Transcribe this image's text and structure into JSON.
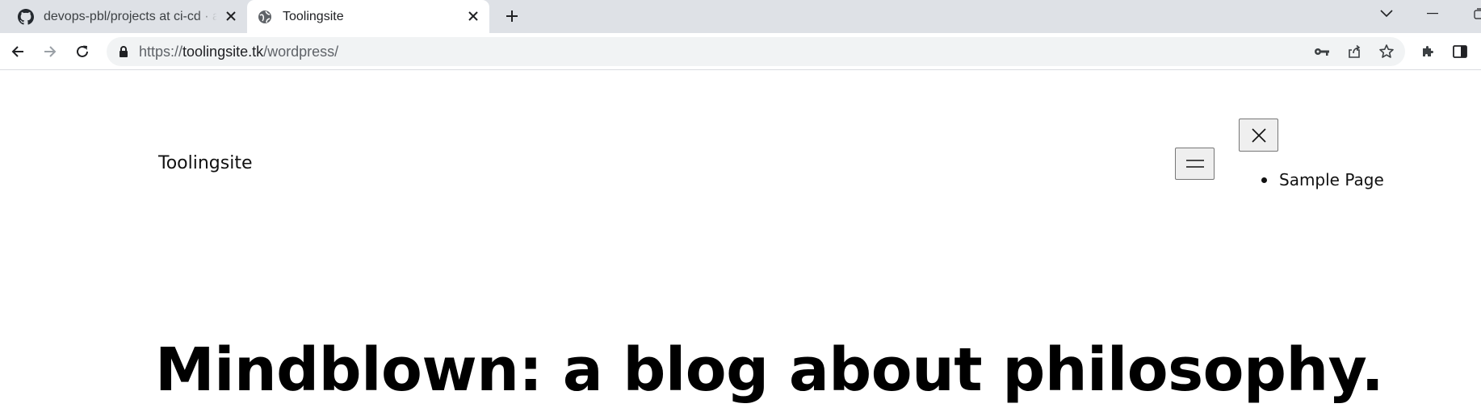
{
  "browser": {
    "tabs": [
      {
        "title": "devops-pbl/projects at ci-cd · ahm",
        "favicon": "github-icon",
        "active": false
      },
      {
        "title": "Toolingsite",
        "favicon": "globe-icon",
        "active": true
      }
    ],
    "address_bar": {
      "scheme": "https://",
      "host": "toolingsite.tk",
      "path": "/wordpress/"
    }
  },
  "page": {
    "site_title": "Toolingsite",
    "nav_items": [
      "Sample Page"
    ],
    "headline": "Mindblown: a blog about philosophy."
  }
}
